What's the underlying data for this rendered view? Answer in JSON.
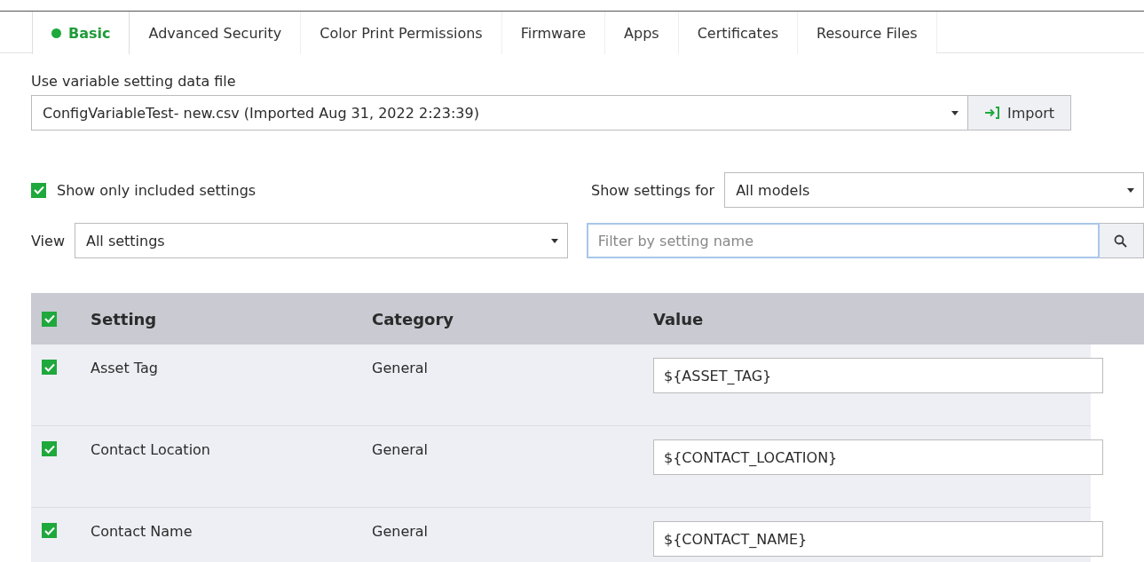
{
  "tabs": [
    {
      "label": "Basic",
      "selected": true
    },
    {
      "label": "Advanced Security",
      "selected": false
    },
    {
      "label": "Color Print Permissions",
      "selected": false
    },
    {
      "label": "Firmware",
      "selected": false
    },
    {
      "label": "Apps",
      "selected": false
    },
    {
      "label": "Certificates",
      "selected": false
    },
    {
      "label": "Resource Files",
      "selected": false
    }
  ],
  "data_file": {
    "label": "Use variable setting data file",
    "value": "ConfigVariableTest- new.csv (Imported Aug 31, 2022 2:23:39)",
    "import_button": "Import"
  },
  "show_only_included": {
    "label": "Show only included settings",
    "checked": true
  },
  "show_settings_for": {
    "label": "Show settings for",
    "value": "All models"
  },
  "view": {
    "label": "View",
    "value": "All settings"
  },
  "filter": {
    "placeholder": "Filter by setting name"
  },
  "table": {
    "header_checked": true,
    "columns": [
      "Setting",
      "Category",
      "Value"
    ],
    "rows": [
      {
        "checked": true,
        "setting": "Asset Tag",
        "category": "General",
        "value": "${ASSET_TAG}"
      },
      {
        "checked": true,
        "setting": "Contact Location",
        "category": "General",
        "value": "${CONTACT_LOCATION}"
      },
      {
        "checked": true,
        "setting": "Contact Name",
        "category": "General",
        "value": "${CONTACT_NAME}"
      }
    ]
  }
}
